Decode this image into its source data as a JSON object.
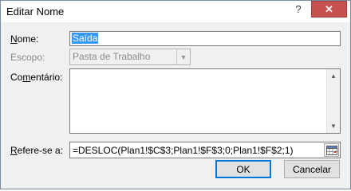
{
  "window": {
    "title": "Editar Nome",
    "help_label": "?",
    "close_label": "✕"
  },
  "fields": {
    "name": {
      "label": "Nome:",
      "value": "Saída"
    },
    "scope": {
      "label": "Escopo:",
      "value": "Pasta de Trabalho"
    },
    "comment": {
      "label": "Comentário:",
      "value": ""
    },
    "refers_to": {
      "label": "Refere-se a:",
      "value": "=DESLOC(Plan1!$C$3;Plan1!$F$3;0;Plan1!$F$2;1)"
    }
  },
  "buttons": {
    "ok": "OK",
    "cancel": "Cancelar"
  },
  "icons": {
    "scope_dropdown": "chevron-down-icon",
    "refers_collapse": "range-select-icon",
    "scroll_up": "scroll-up-icon",
    "scroll_down": "scroll-down-icon"
  }
}
